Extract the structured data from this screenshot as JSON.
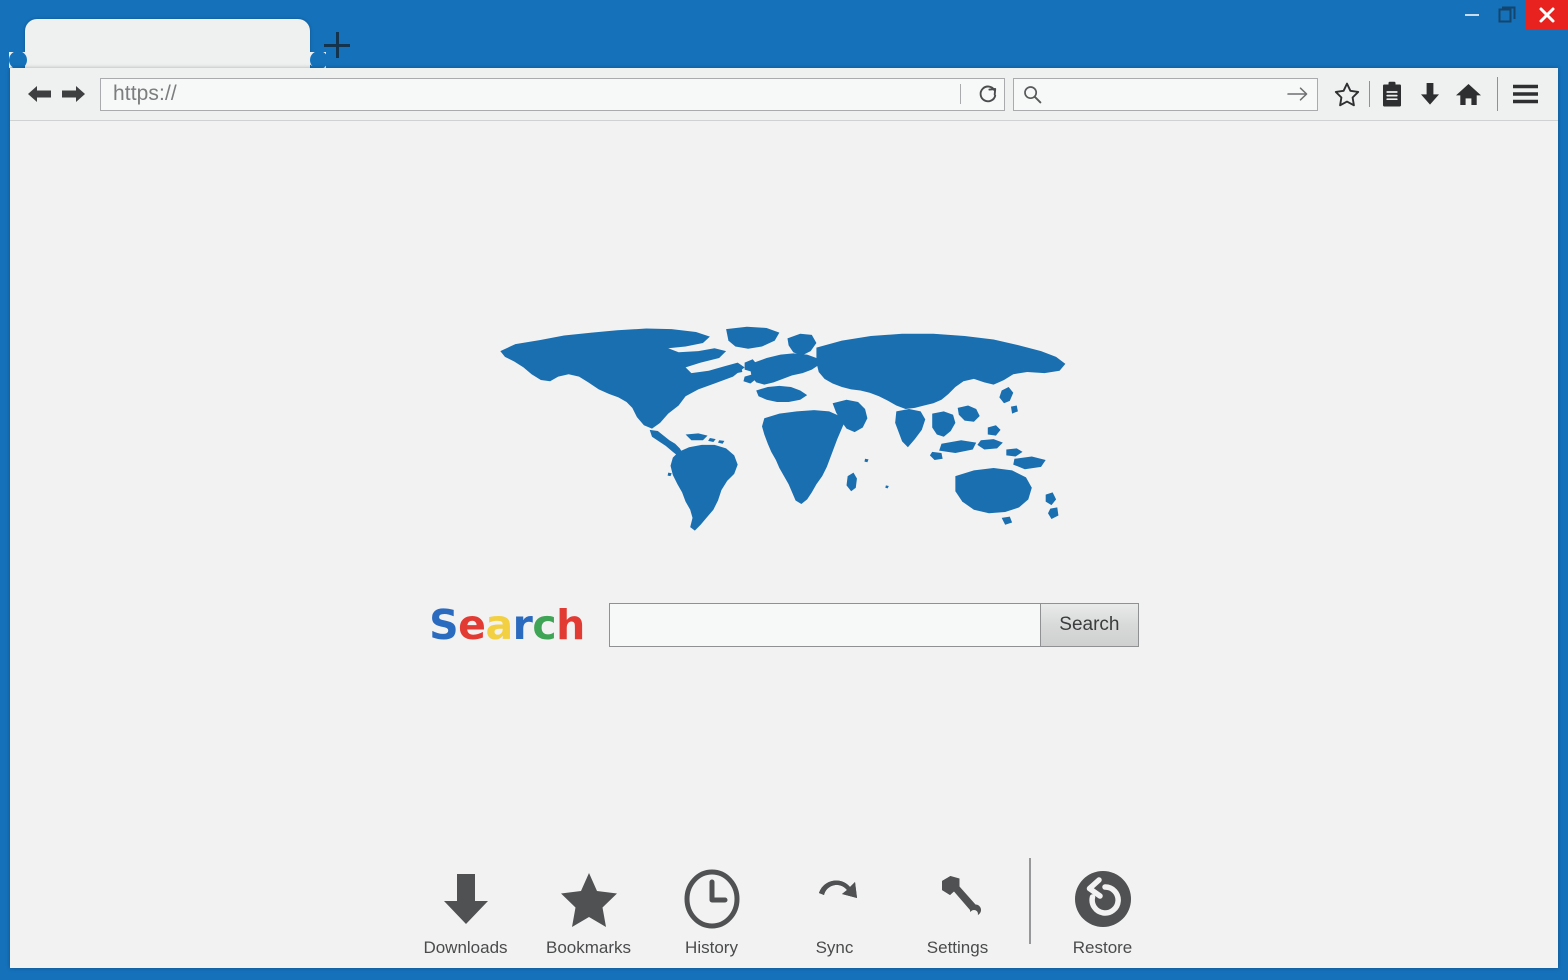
{
  "window": {
    "chrome_blue": "#1571ba",
    "close_red": "#e8231f",
    "controls": [
      {
        "name": "minimize",
        "icon": "minimize-icon"
      },
      {
        "name": "maximize",
        "icon": "maximize-restore-icon"
      },
      {
        "name": "close",
        "icon": "close-icon"
      }
    ]
  },
  "tabs": {
    "items": [
      {
        "title": ""
      }
    ],
    "new_tab_label": "+",
    "new_tab_icon": "plus-icon"
  },
  "toolbar": {
    "back_icon": "back-arrow-icon",
    "forward_icon": "forward-arrow-icon",
    "address": {
      "value": "https://",
      "placeholder": "https://",
      "reload_icon": "reload-icon"
    },
    "search": {
      "value": "",
      "placeholder": "",
      "icon": "search-icon",
      "go_icon": "arrow-right-icon"
    },
    "icons": [
      {
        "name": "bookmark-star-icon",
        "label": "Bookmark"
      },
      {
        "name": "reading-list-icon",
        "label": "Reading list"
      },
      {
        "name": "downloads-arrow-icon",
        "label": "Downloads"
      },
      {
        "name": "home-icon",
        "label": "Home"
      },
      {
        "name": "menu-hamburger-icon",
        "label": "Menu"
      }
    ]
  },
  "page": {
    "background": "#f2f2f2",
    "map": {
      "name": "world-map",
      "fill": "#1a6fb0"
    },
    "logo": {
      "text": "Search",
      "letters": [
        {
          "char": "S",
          "color": "#2b6bbf"
        },
        {
          "char": "e",
          "color": "#e23b33"
        },
        {
          "char": "a",
          "color": "#f2d042"
        },
        {
          "char": "r",
          "color": "#2b6bbf"
        },
        {
          "char": "c",
          "color": "#3fa455"
        },
        {
          "char": "h",
          "color": "#e23b33"
        }
      ]
    },
    "search_form": {
      "input_value": "",
      "input_placeholder": "",
      "button_label": "Search"
    },
    "shortcuts": [
      {
        "label": "Downloads",
        "icon": "download-arrow-icon"
      },
      {
        "label": "Bookmarks",
        "icon": "star-filled-icon"
      },
      {
        "label": "History",
        "icon": "clock-icon"
      },
      {
        "label": "Sync",
        "icon": "sync-refresh-icon"
      },
      {
        "label": "Settings",
        "icon": "wrench-icon"
      },
      {
        "label": "Restore",
        "icon": "restore-circle-icon"
      }
    ]
  }
}
